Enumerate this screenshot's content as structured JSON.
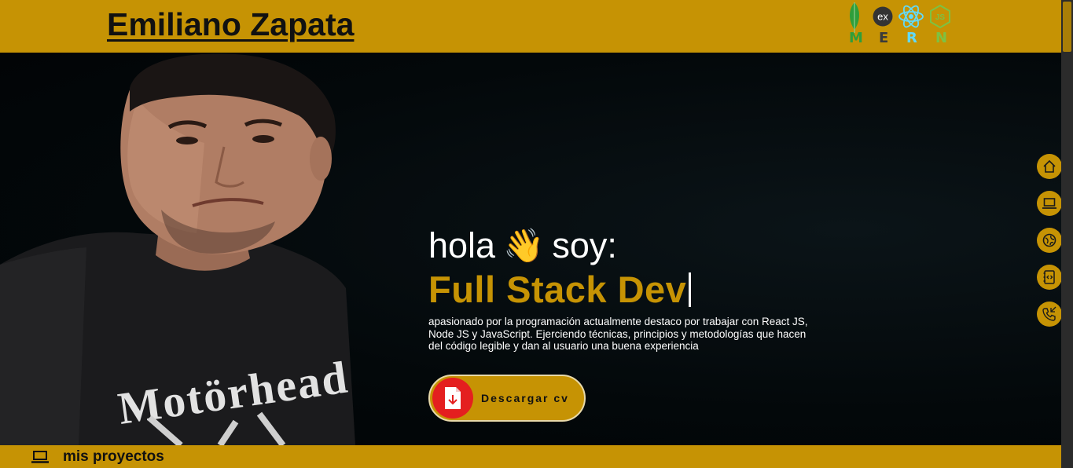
{
  "header": {
    "brand": "Emiliano Zapata",
    "stack": {
      "labels": [
        "M",
        "E",
        "R",
        "N"
      ],
      "badge_text": "ex",
      "icons": [
        "mongodb-leaf-icon",
        "express-icon",
        "react-icon",
        "nodejs-icon"
      ]
    }
  },
  "hero": {
    "greeting": "hola",
    "greeting_emoji": "👋",
    "greeting_suffix": "soy:",
    "role": "Full Stack Dev",
    "description": "apasionado por la programación actualmente destaco por trabajar con React JS, Node JS y JavaScript. Ejerciendo técnicas, principios y metodologías que hacen del código legible y dan al usuario una buena experiencia",
    "cv_button": "Descargar cv"
  },
  "sidenav": [
    "home-icon",
    "laptop-icon",
    "globe-icon",
    "code-notebook-icon",
    "phone-icon"
  ],
  "footer": {
    "label": "mis proyectos"
  },
  "colors": {
    "accent": "#c69304",
    "background": "#020608",
    "cv_icon": "#e41f1f"
  }
}
